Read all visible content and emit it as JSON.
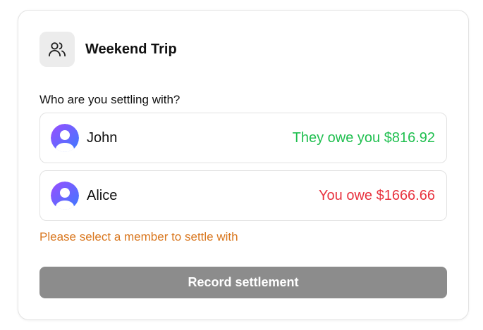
{
  "group": {
    "icon": "users-icon",
    "title": "Weekend Trip"
  },
  "prompt": "Who are you settling with?",
  "members": [
    {
      "name": "John",
      "balance": "They owe you $816.92",
      "balance_color": "#1fbf4f",
      "avatar": "user-avatar-icon"
    },
    {
      "name": "Alice",
      "balance": "You owe $1666.66",
      "balance_color": "#e8333f",
      "avatar": "user-avatar-icon"
    }
  ],
  "validation_message": "Please select a member to settle with",
  "record_button": {
    "label": "Record settlement",
    "disabled": true
  },
  "colors": {
    "avatar_gradient_top": "#8a4dff",
    "avatar_gradient_bottom": "#3b7bff",
    "warning": "#d9771f",
    "button_disabled": "#8c8c8c"
  }
}
